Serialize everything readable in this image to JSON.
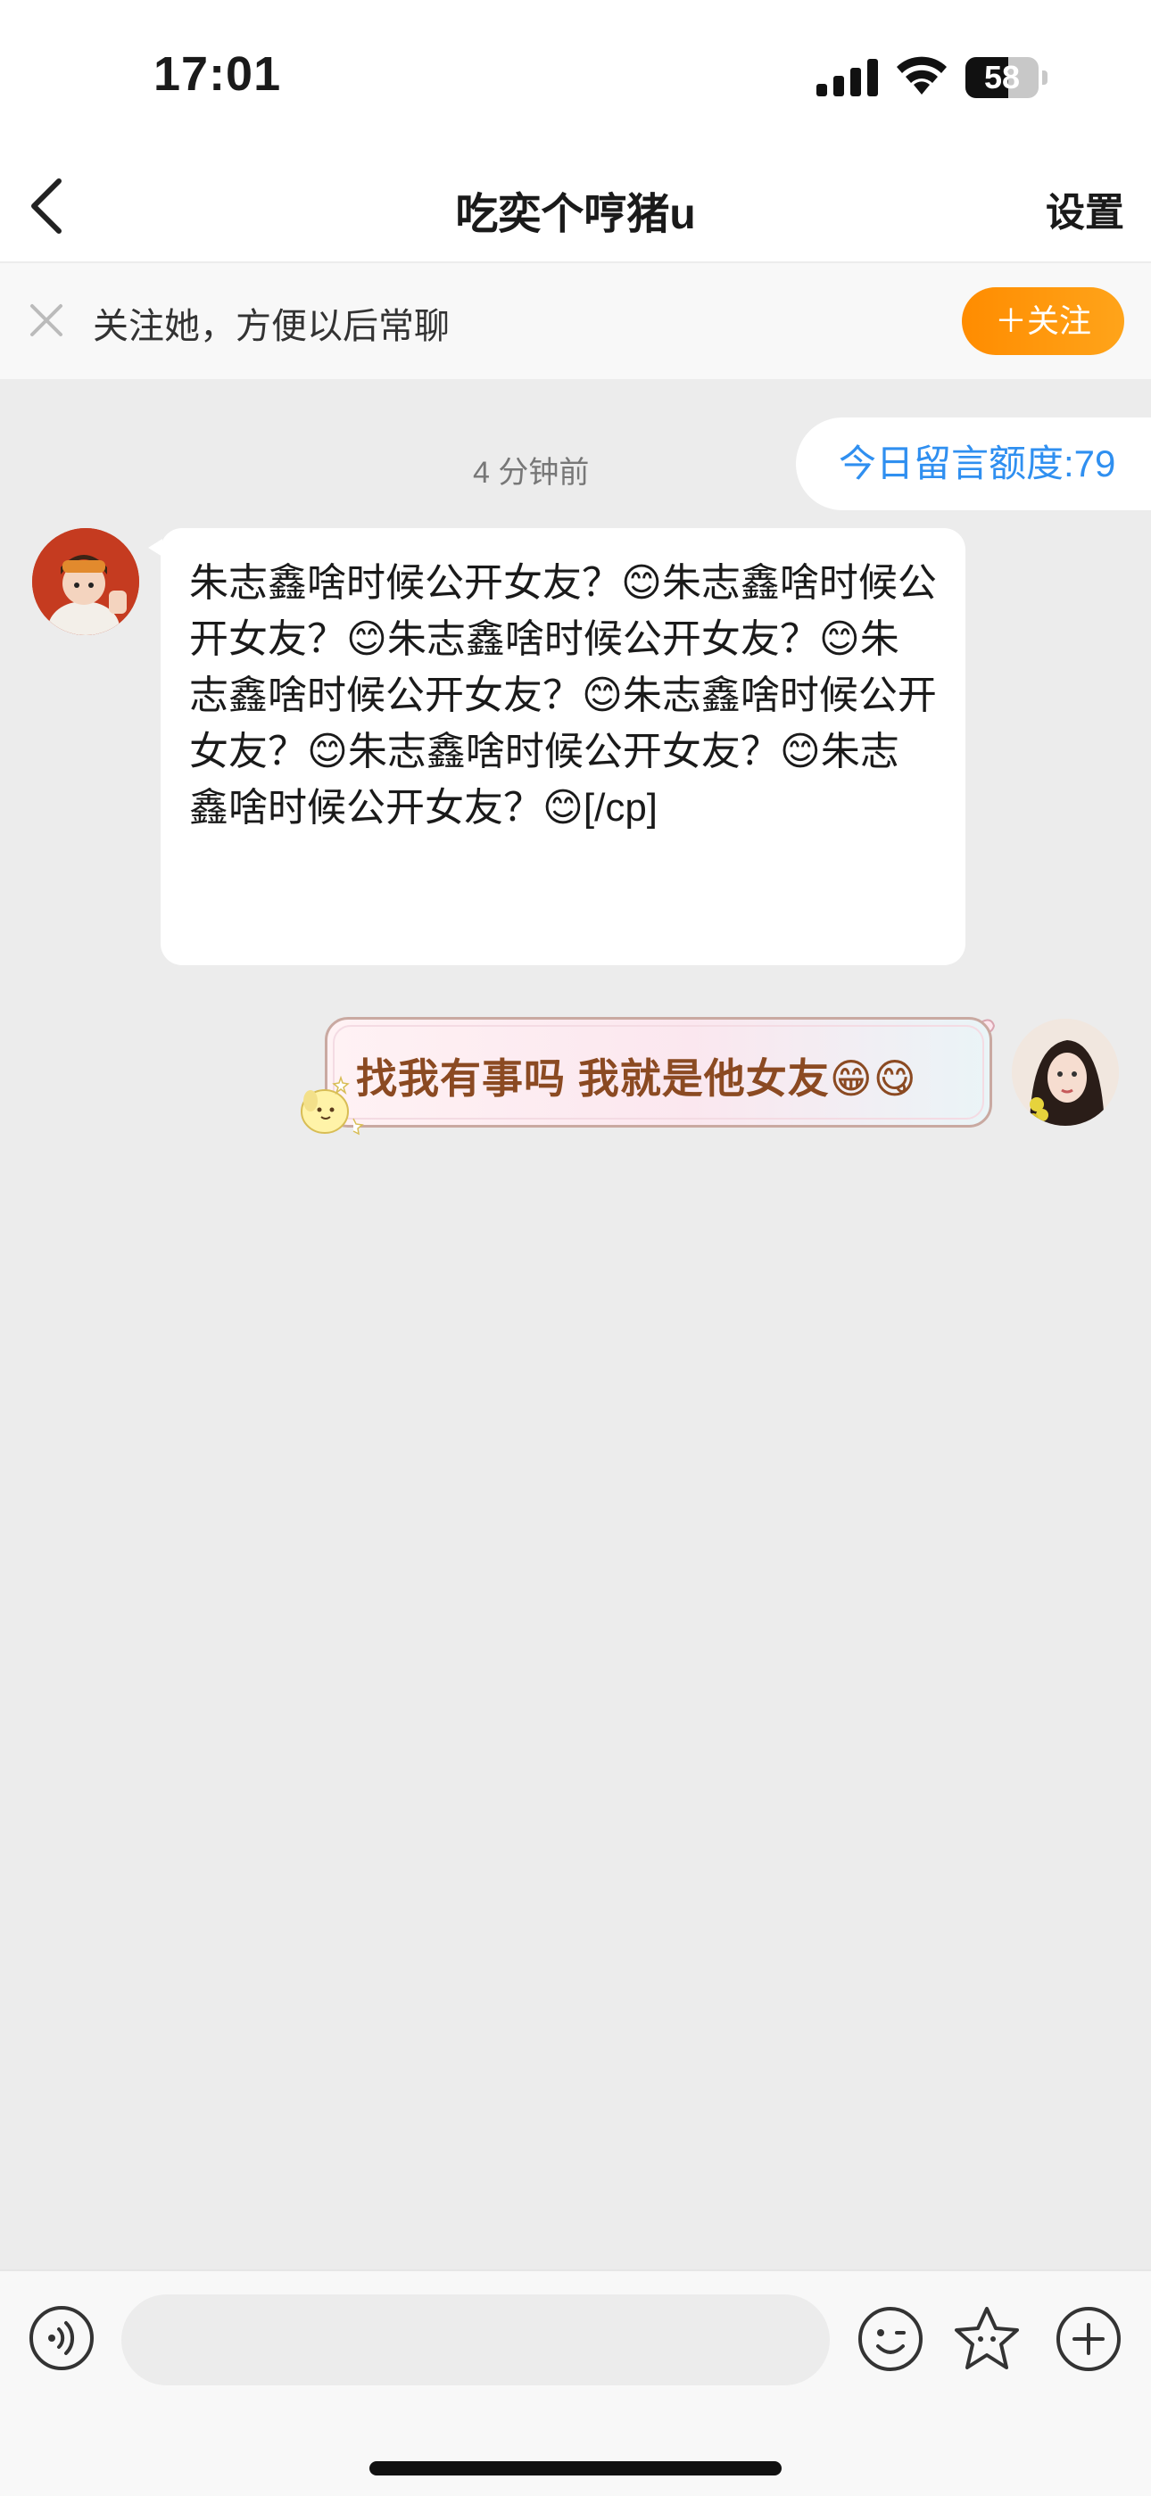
{
  "status_bar": {
    "time": "17:01",
    "battery_level": "58",
    "battery_fraction": 0.58
  },
  "nav": {
    "title": "吃奕个哼猪u",
    "settings_label": "设置"
  },
  "follow_banner": {
    "text": "关注她，方便以后常聊",
    "button_label": "＋关注"
  },
  "chat": {
    "timestamp": "4 分钟前",
    "quota_label": "今日留言额度:79",
    "messages": [
      {
        "sender": "other",
        "text": "朱志鑫啥时候公开女友？😊朱志鑫啥时候公开女友？😊朱志鑫啥时候公开女友？😊朱志鑫啥时候公开女友？😊朱志鑫啥时候公开女友？😊朱志鑫啥时候公开女友？😊朱志鑫啥时候公开女友？😊[/cp]"
      },
      {
        "sender": "me",
        "text": "找我有事吗 我就是他女友😁😋"
      }
    ]
  },
  "input": {
    "placeholder": ""
  },
  "colors": {
    "accent_orange": "#ff8c00",
    "quota_blue": "#2f8ff0",
    "background": "#ececec"
  },
  "icons": [
    "back-icon",
    "close-icon",
    "signal-icon",
    "wifi-icon",
    "battery-icon",
    "voice-icon",
    "emoji-icon",
    "sticker-icon",
    "plus-icon"
  ]
}
